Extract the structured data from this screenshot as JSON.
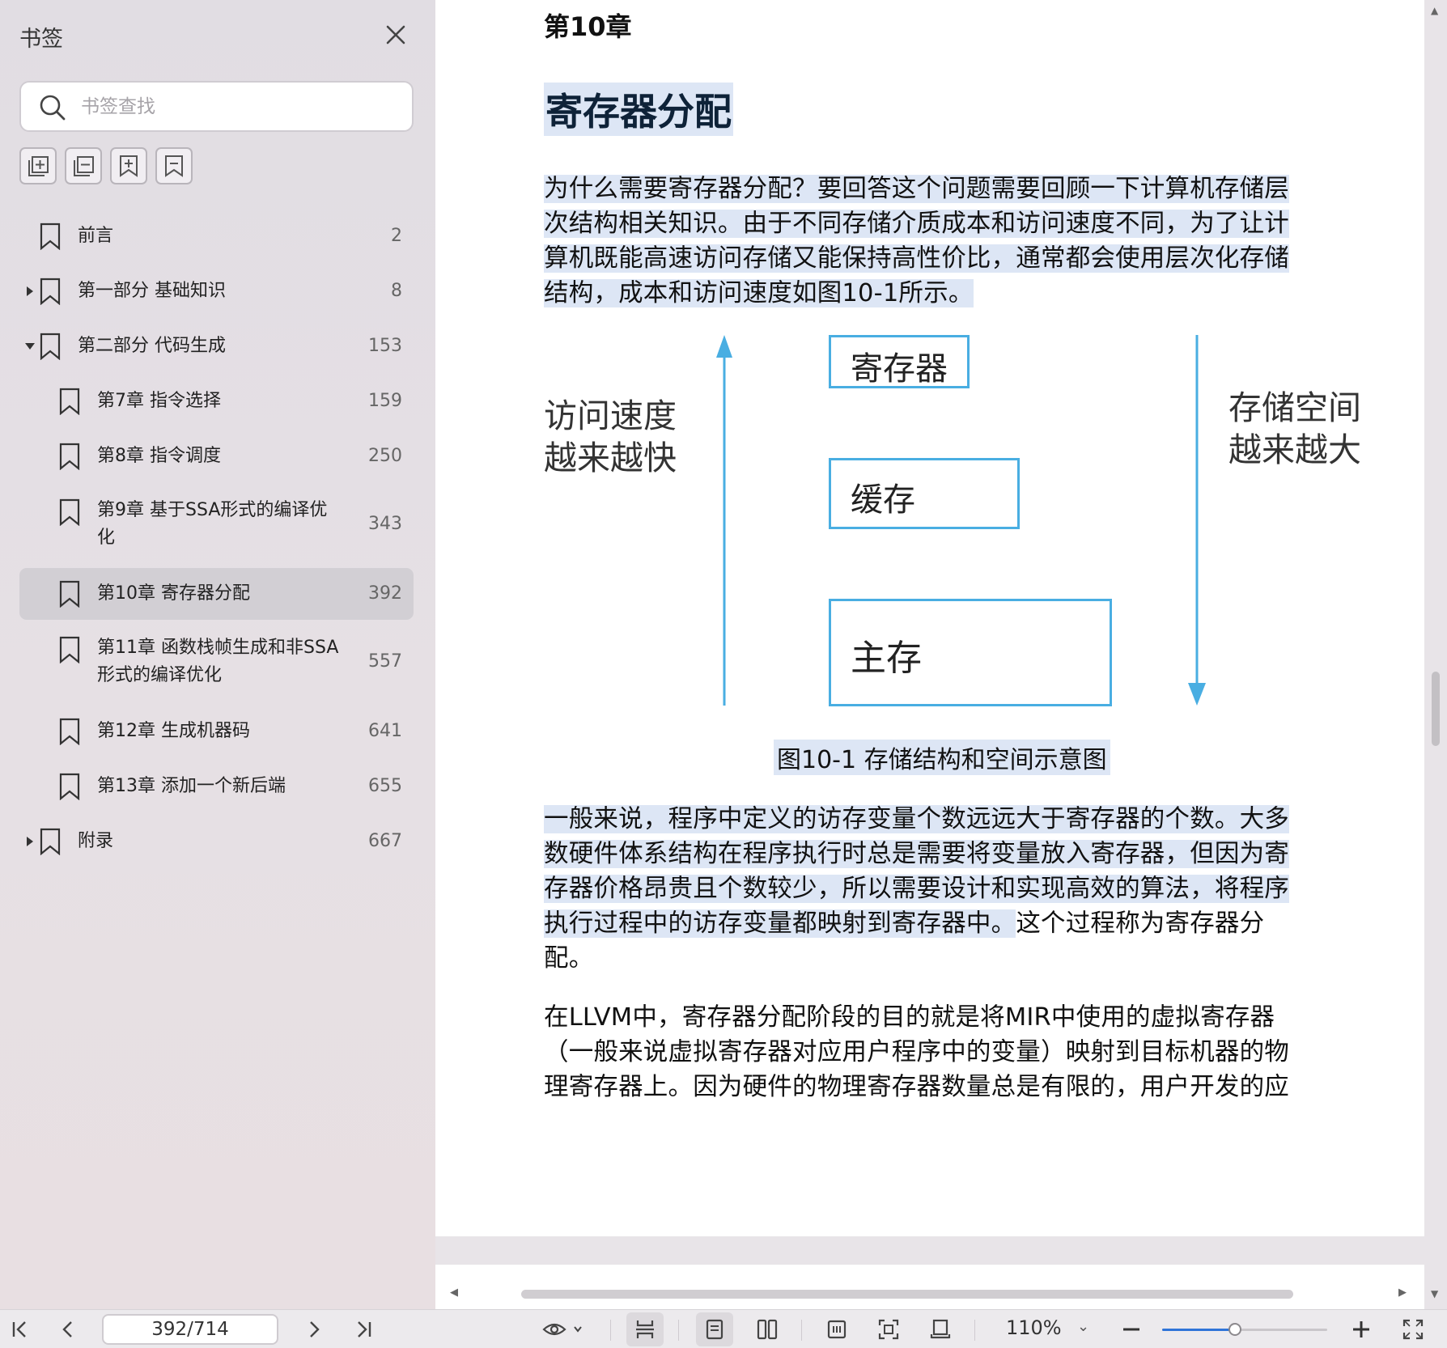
{
  "sidebar": {
    "title": "书签",
    "search_placeholder": "书签查找",
    "items": [
      {
        "label": "前言",
        "page": "2",
        "level": 0,
        "arrow": "none"
      },
      {
        "label": "第一部分 基础知识",
        "page": "8",
        "level": 0,
        "arrow": "collapsed"
      },
      {
        "label": "第二部分 代码生成",
        "page": "153",
        "level": 0,
        "arrow": "expanded"
      },
      {
        "label": "第7章 指令选择",
        "page": "159",
        "level": 1,
        "arrow": "none"
      },
      {
        "label": "第8章 指令调度",
        "page": "250",
        "level": 1,
        "arrow": "none"
      },
      {
        "label_line1": "第9章 基于SSA形式的编译优",
        "label_line2": "化",
        "page": "343",
        "level": 1,
        "arrow": "none"
      },
      {
        "label": "第10章 寄存器分配",
        "page": "392",
        "level": 1,
        "arrow": "none",
        "active": true
      },
      {
        "label_line1": "第11章 函数栈帧生成和非SSA",
        "label_line2": "形式的编译优化",
        "page": "557",
        "level": 1,
        "arrow": "none"
      },
      {
        "label": "第12章 生成机器码",
        "page": "641",
        "level": 1,
        "arrow": "none"
      },
      {
        "label": "第13章 添加一个新后端",
        "page": "655",
        "level": 1,
        "arrow": "none"
      },
      {
        "label": "附录",
        "page": "667",
        "level": 0,
        "arrow": "collapsed"
      }
    ]
  },
  "document": {
    "chapter_number": "第10章",
    "chapter_title": "寄存器分配",
    "para1_lines": [
      "为什么需要寄存器分配？要回答这个问题需要回顾一下计算机存储层",
      "次结构相关知识。由于不同存储介质成本和访问速度不同，为了让计",
      "算机既能高速访问存储又能保持高性价比，通常都会使用层次化存储",
      "结构，成本和访问速度如图10-1所示。"
    ],
    "figure": {
      "left_label_line1": "访问速度",
      "left_label_line2": "越来越快",
      "right_label_line1": "存储空间",
      "right_label_line2": "越来越大",
      "box1": "寄存器",
      "box2": "缓存",
      "box3": "主存",
      "caption": "图10-1 存储结构和空间示意图",
      "line_color": "#49aee2"
    },
    "para2_lines": [
      "一般来说，程序中定义的访存变量个数远远大于寄存器的个数。大多",
      "数硬件体系结构在程序执行时总是需要将变量放入寄存器，但因为寄",
      "存器价格昂贵且个数较少，所以需要设计和实现高效的算法，将程序",
      "执行过程中的访存变量都映射到寄存器中。",
      "这个过程称为寄存器分",
      "配。"
    ],
    "para3_lines": [
      "在LLVM中，寄存器分配阶段的目的就是将MIR中使用的虚拟寄存器",
      "（一般来说虚拟寄存器对应用户程序中的变量）映射到目标机器的物",
      "理寄存器上。因为硬件的物理寄存器数量总是有限的，用户开发的应"
    ],
    "highlight_color": "#dde6f5"
  },
  "bottombar": {
    "page_indicator": "392/714",
    "zoom_label": "110%",
    "zoom_slider_fraction": 0.44,
    "accent_color": "#2f74d8"
  }
}
